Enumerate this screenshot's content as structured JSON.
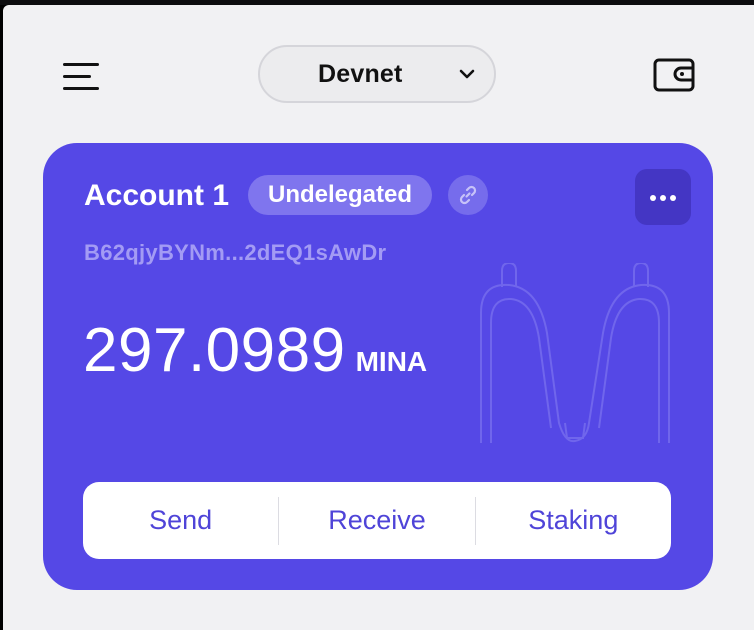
{
  "header": {
    "menu_icon": "hamburger-menu-icon",
    "network": "Devnet",
    "network_chevron_icon": "chevron-down-icon",
    "wallet_icon": "wallet-icon"
  },
  "account_card": {
    "name": "Account 1",
    "status_badge": "Undelegated",
    "link_icon": "link-icon",
    "more_icon": "more-horizontal-icon",
    "address": "B62qjyBYNm...2dEQ1sAwDr",
    "balance": "297.0989",
    "unit": "MINA",
    "watermark_icon": "mina-logo-icon",
    "colors": {
      "card_background": "#5548e6",
      "badge_background": "#7f75ee",
      "action_text": "#4f44d8"
    }
  },
  "actions": {
    "send": "Send",
    "receive": "Receive",
    "staking": "Staking"
  }
}
